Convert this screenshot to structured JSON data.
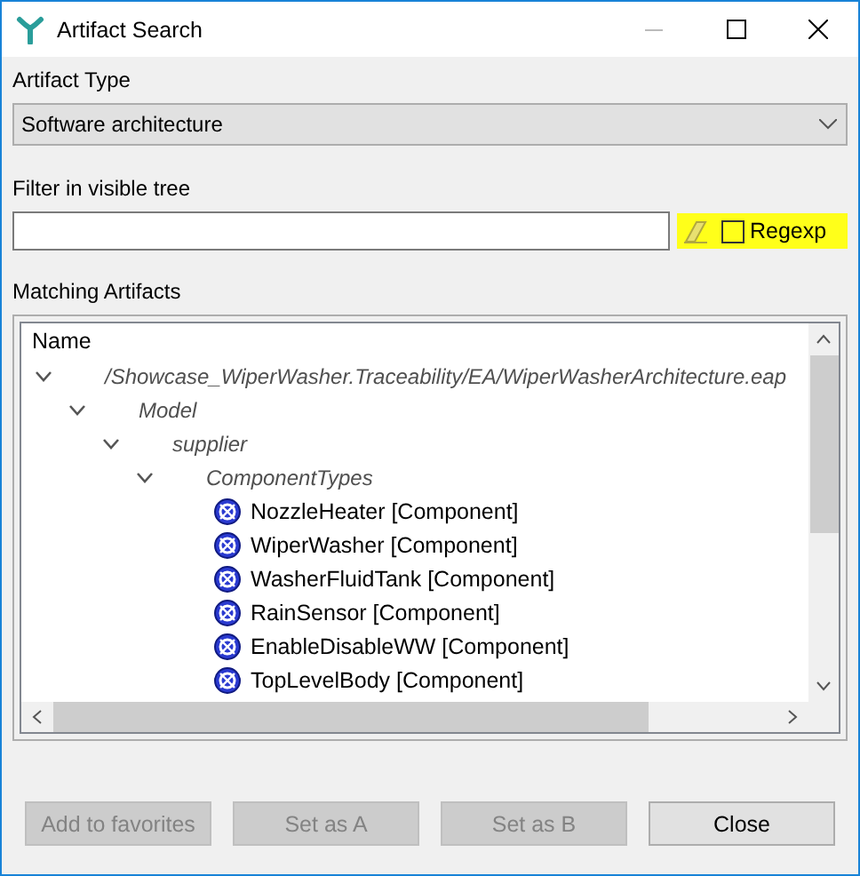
{
  "window": {
    "title": "Artifact Search"
  },
  "artifact_type": {
    "label": "Artifact Type",
    "value": "Software architecture"
  },
  "filter": {
    "label": "Filter in visible tree",
    "regexp": {
      "label": "Regexp",
      "checked": false
    }
  },
  "matching": {
    "label": "Matching Artifacts",
    "column": "Name",
    "tree": [
      {
        "kind": "folder",
        "label": "/Showcase_WiperWasher.Traceability/EA/WiperWasherArchitecture.eap",
        "expanded": true,
        "children": [
          {
            "kind": "folder",
            "label": "Model",
            "expanded": true,
            "children": [
              {
                "kind": "folder",
                "label": "supplier",
                "expanded": true,
                "children": [
                  {
                    "kind": "folder",
                    "label": "ComponentTypes",
                    "expanded": true,
                    "children": [
                      {
                        "kind": "component",
                        "label": "NozzleHeater [Component]"
                      },
                      {
                        "kind": "component",
                        "label": "WiperWasher [Component]"
                      },
                      {
                        "kind": "component",
                        "label": "WasherFluidTank [Component]"
                      },
                      {
                        "kind": "component",
                        "label": "RainSensor [Component]"
                      },
                      {
                        "kind": "component",
                        "label": "EnableDisableWW [Component]"
                      },
                      {
                        "kind": "component",
                        "label": "TopLevelBody [Component]"
                      }
                    ]
                  }
                ]
              }
            ]
          }
        ]
      }
    ]
  },
  "buttons": [
    {
      "label": "Add to favorites",
      "disabled": true
    },
    {
      "label": "Set as A",
      "disabled": true
    },
    {
      "label": "Set as B",
      "disabled": true
    },
    {
      "label": "Close",
      "disabled": false
    }
  ]
}
